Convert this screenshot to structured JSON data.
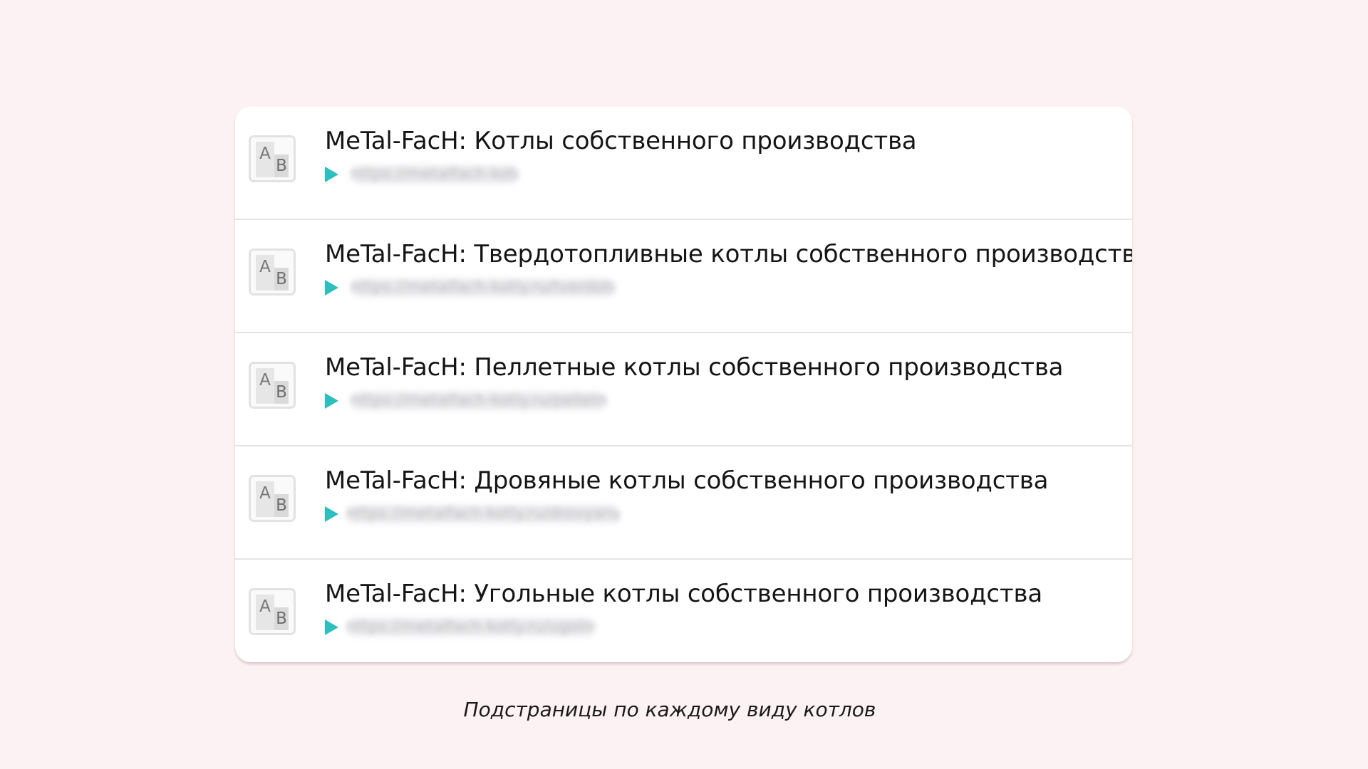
{
  "accent_color": "#2bbfc0",
  "items": [
    {
      "icon": "ab-test-icon",
      "title": "MeTal-FacH: Котлы собственного производства",
      "url": "https://metalfach-kotly.ru/"
    },
    {
      "icon": "ab-test-icon",
      "title": "MeTal-FacH: Твердотопливные котлы собственного производства",
      "url": "https://metalfach-kotly.ru/tverdotoplivnye"
    },
    {
      "icon": "ab-test-icon",
      "title": "MeTal-FacH: Пеллетные котлы собственного производства",
      "url": "https://metalfach-kotly.ru/pelletnye"
    },
    {
      "icon": "ab-test-icon",
      "title": "MeTal-FacH: Дровяные котлы собственного производства",
      "url": "https://metalfach-kotly.ru/drovyanye"
    },
    {
      "icon": "ab-test-icon",
      "title": "MeTal-FacH: Угольные котлы собственного производства",
      "url": "https://metalfach-kotly.ru/ugolnye"
    }
  ],
  "caption": "Подстраницы по каждому виду котлов"
}
